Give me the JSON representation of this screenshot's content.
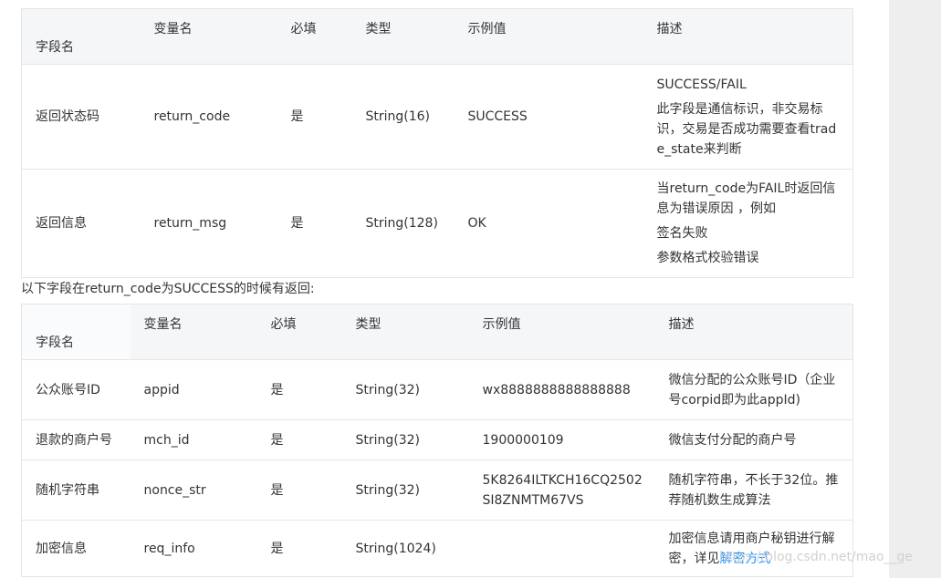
{
  "table1": {
    "headers": [
      "字段名",
      "变量名",
      "必填",
      "类型",
      "示例值",
      "描述"
    ],
    "rows": [
      {
        "name": "返回状态码",
        "var": "return_code",
        "required": "是",
        "type": "String(16)",
        "example": "SUCCESS",
        "desc": [
          "SUCCESS/FAIL",
          "此字段是通信标识，非交易标识，交易是否成功需要查看trade_state来判断"
        ]
      },
      {
        "name": "返回信息",
        "var": "return_msg",
        "required": "是",
        "type": "String(128)",
        "example": "OK",
        "desc": [
          "当return_code为FAIL时返回信息为错误原因 ，例如",
          "签名失败",
          "参数格式校验错误"
        ]
      }
    ]
  },
  "note": "以下字段在return_code为SUCCESS的时候有返回:",
  "table2": {
    "headers": [
      "字段名",
      "变量名",
      "必填",
      "类型",
      "示例值",
      "描述"
    ],
    "rows": [
      {
        "name": "公众账号ID",
        "var": "appid",
        "required": "是",
        "type": "String(32)",
        "example": "wx8888888888888888",
        "desc": "微信分配的公众账号ID（企业号corpid即为此appId)"
      },
      {
        "name": "退款的商户号",
        "var": "mch_id",
        "required": "是",
        "type": "String(32)",
        "example": "1900000109",
        "desc": "微信支付分配的商户号"
      },
      {
        "name": "随机字符串",
        "var": "nonce_str",
        "required": "是",
        "type": "String(32)",
        "example": "5K8264ILTKCH16CQ2502SI8ZNMTM67VS",
        "desc": "随机字符串，不长于32位。推荐随机数生成算法"
      },
      {
        "name": "加密信息",
        "var": "req_info",
        "required": "是",
        "type": "String(1024)",
        "example": "",
        "desc": "加密信息请用商户秘钥进行解密，详见",
        "desc_link": "解密方式"
      }
    ]
  },
  "watermark": "https://blog.csdn.net/mao__ge"
}
